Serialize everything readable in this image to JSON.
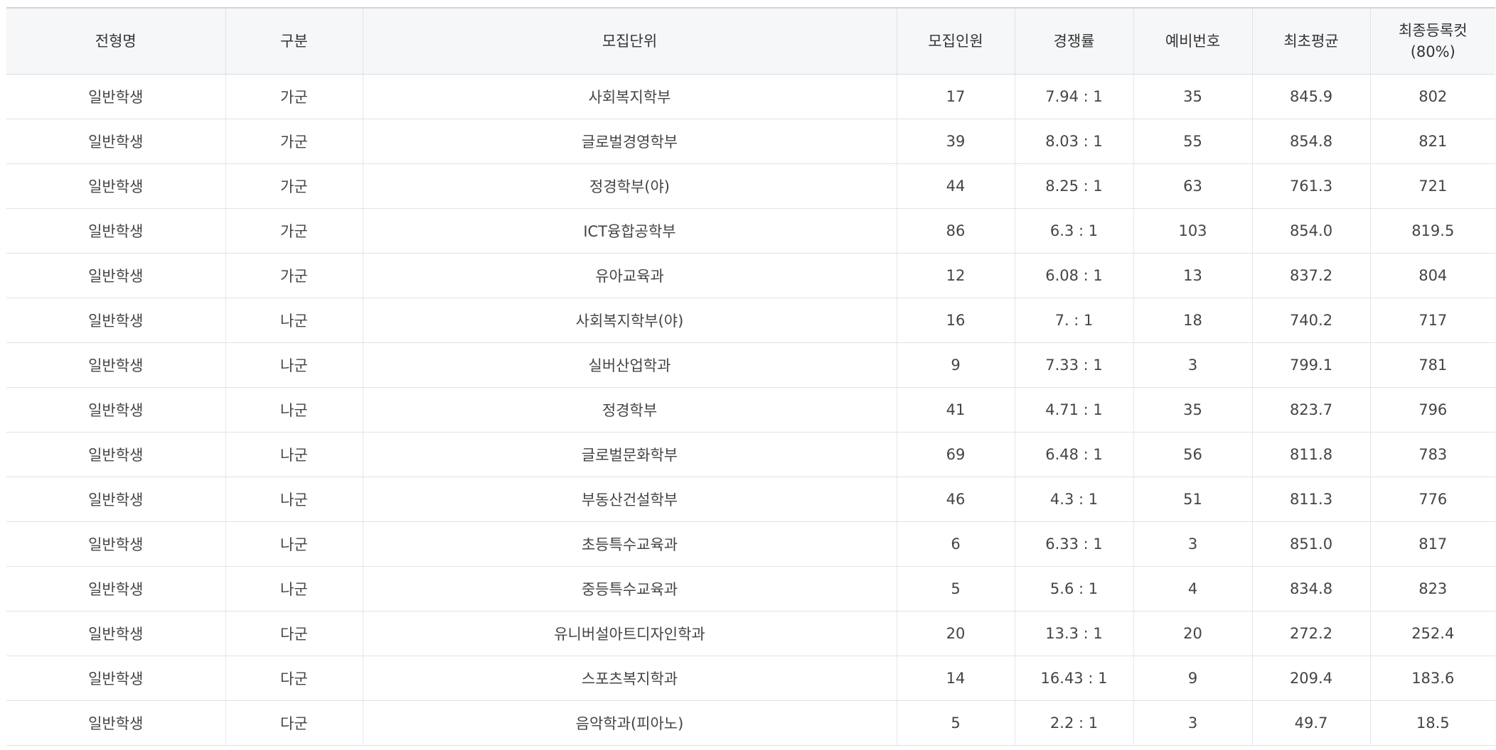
{
  "table": {
    "headers": {
      "col1": "전형명",
      "col2": "구분",
      "col3": "모집단위",
      "col4": "모집인원",
      "col5": "경쟁률",
      "col6": "예비번호",
      "col7": "최초평균",
      "col8_line1": "최종등록컷",
      "col8_line2": "(80%)"
    },
    "rows": [
      [
        "일반학생",
        "가군",
        "사회복지학부",
        "17",
        "7.94 : 1",
        "35",
        "845.9",
        "802"
      ],
      [
        "일반학생",
        "가군",
        "글로벌경영학부",
        "39",
        "8.03 : 1",
        "55",
        "854.8",
        "821"
      ],
      [
        "일반학생",
        "가군",
        "정경학부(야)",
        "44",
        "8.25 : 1",
        "63",
        "761.3",
        "721"
      ],
      [
        "일반학생",
        "가군",
        "ICT융합공학부",
        "86",
        "6.3 : 1",
        "103",
        "854.0",
        "819.5"
      ],
      [
        "일반학생",
        "가군",
        "유아교육과",
        "12",
        "6.08 : 1",
        "13",
        "837.2",
        "804"
      ],
      [
        "일반학생",
        "나군",
        "사회복지학부(야)",
        "16",
        "7. : 1",
        "18",
        "740.2",
        "717"
      ],
      [
        "일반학생",
        "나군",
        "실버산업학과",
        "9",
        "7.33 : 1",
        "3",
        "799.1",
        "781"
      ],
      [
        "일반학생",
        "나군",
        "정경학부",
        "41",
        "4.71 : 1",
        "35",
        "823.7",
        "796"
      ],
      [
        "일반학생",
        "나군",
        "글로벌문화학부",
        "69",
        "6.48 : 1",
        "56",
        "811.8",
        "783"
      ],
      [
        "일반학생",
        "나군",
        "부동산건설학부",
        "46",
        "4.3 : 1",
        "51",
        "811.3",
        "776"
      ],
      [
        "일반학생",
        "나군",
        "초등특수교육과",
        "6",
        "6.33 : 1",
        "3",
        "851.0",
        "817"
      ],
      [
        "일반학생",
        "나군",
        "중등특수교육과",
        "5",
        "5.6 : 1",
        "4",
        "834.8",
        "823"
      ],
      [
        "일반학생",
        "다군",
        "유니버설아트디자인학과",
        "20",
        "13.3 : 1",
        "20",
        "272.2",
        "252.4"
      ],
      [
        "일반학생",
        "다군",
        "스포츠복지학과",
        "14",
        "16.43 : 1",
        "9",
        "209.4",
        "183.6"
      ],
      [
        "일반학생",
        "다군",
        "음악학과(피아노)",
        "5",
        "2.2 : 1",
        "3",
        "49.7",
        "18.5"
      ]
    ]
  }
}
